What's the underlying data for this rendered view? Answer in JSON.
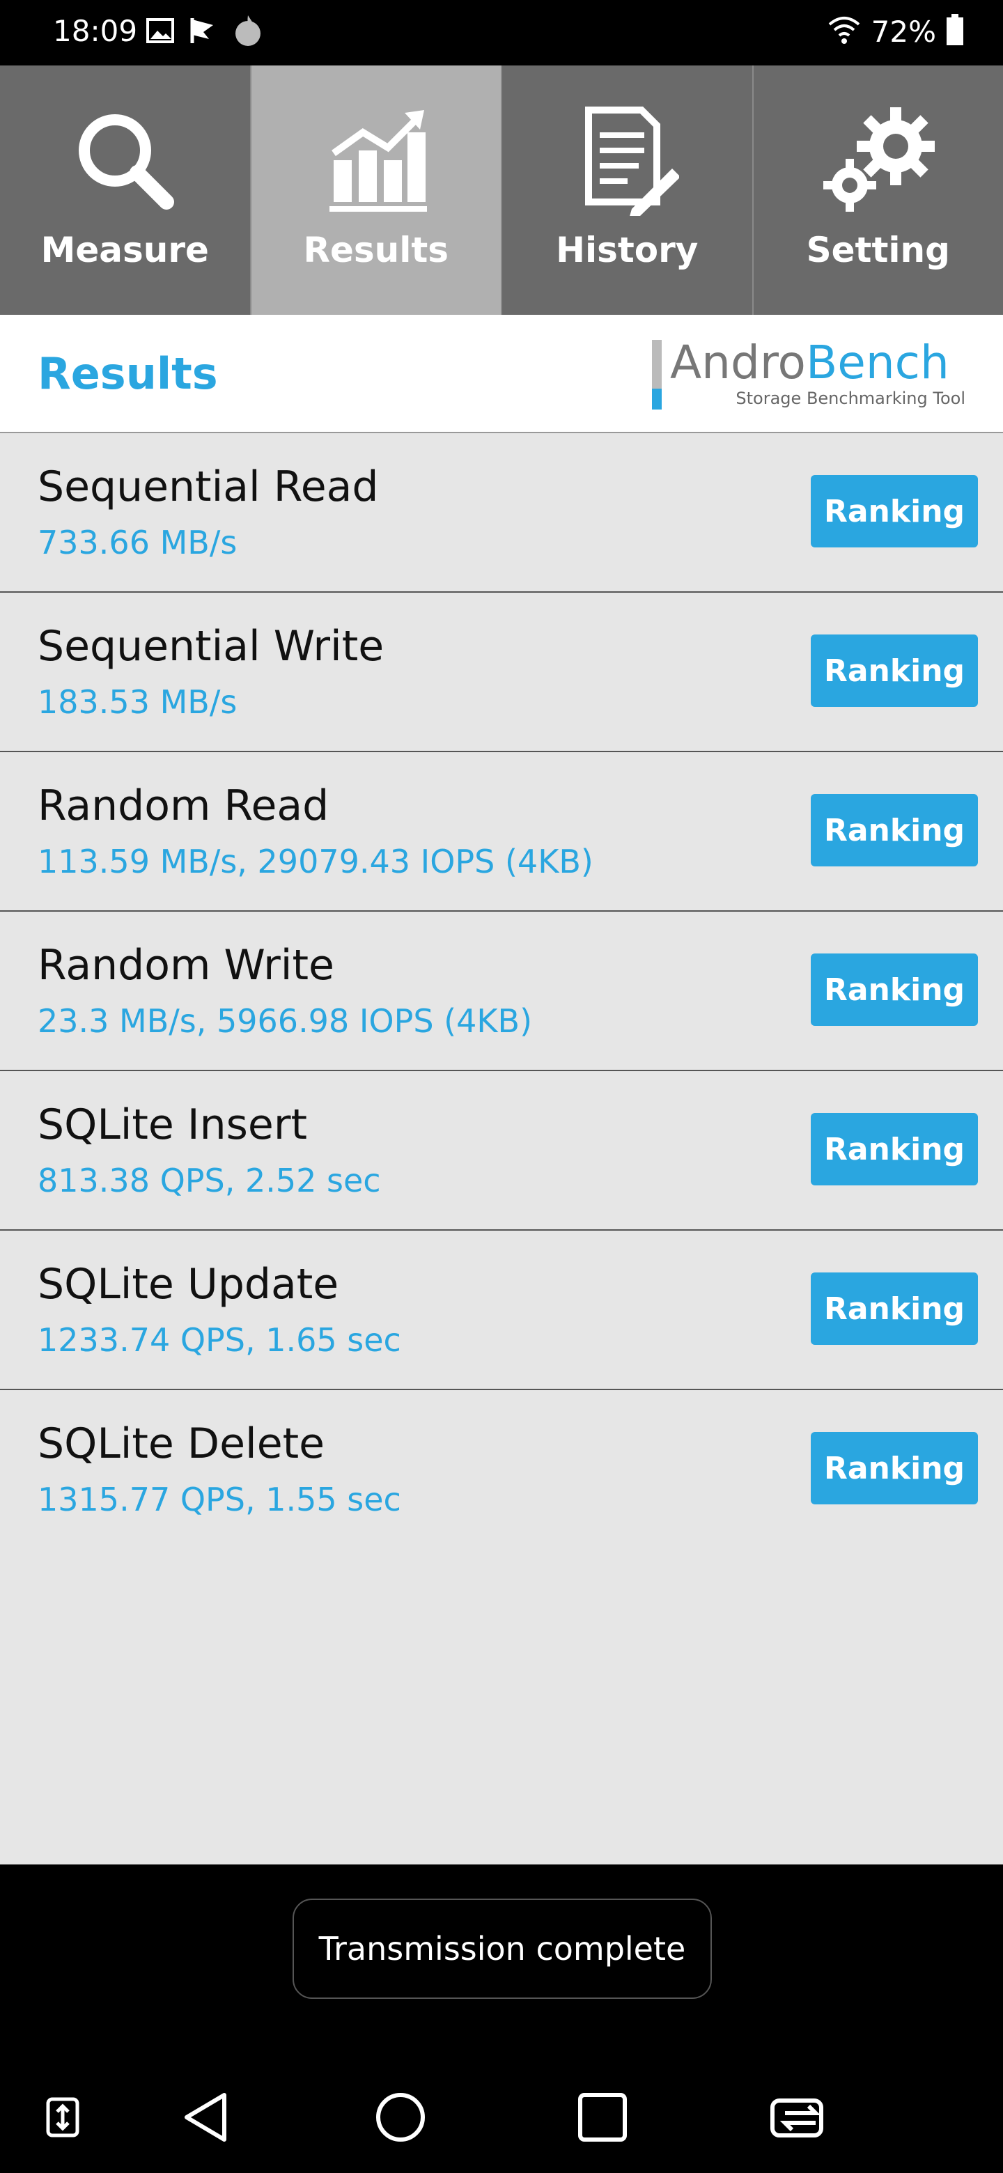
{
  "status_bar": {
    "time": "18:09",
    "left_icons": [
      "image-icon",
      "check-flag-icon",
      "flame-icon"
    ],
    "battery_percent": "72%",
    "right_icons": [
      "wifi-icon",
      "battery-icon"
    ]
  },
  "tabs": [
    {
      "label": "Measure",
      "icon": "search-icon",
      "active": false
    },
    {
      "label": "Results",
      "icon": "chart-icon",
      "active": true
    },
    {
      "label": "History",
      "icon": "document-edit-icon",
      "active": false
    },
    {
      "label": "Setting",
      "icon": "gears-icon",
      "active": false
    }
  ],
  "header": {
    "title": "Results",
    "logo_andro": "Andro",
    "logo_bench": "Bench",
    "logo_tagline": "Storage Benchmarking Tool"
  },
  "results": [
    {
      "name": "Sequential Read",
      "value": "733.66 MB/s",
      "button": "Ranking"
    },
    {
      "name": "Sequential Write",
      "value": "183.53 MB/s",
      "button": "Ranking"
    },
    {
      "name": "Random Read",
      "value": "113.59 MB/s, 29079.43 IOPS (4KB)",
      "button": "Ranking"
    },
    {
      "name": "Random Write",
      "value": "23.3 MB/s, 5966.98 IOPS (4KB)",
      "button": "Ranking"
    },
    {
      "name": "SQLite Insert",
      "value": "813.38 QPS, 2.52 sec",
      "button": "Ranking"
    },
    {
      "name": "SQLite Update",
      "value": "1233.74 QPS, 1.65 sec",
      "button": "Ranking"
    },
    {
      "name": "SQLite Delete",
      "value": "1315.77 QPS, 1.55 sec",
      "button": "Ranking"
    }
  ],
  "toast": "Transmission complete",
  "nav": [
    "scroll-capture-icon",
    "back-icon",
    "home-icon",
    "recents-icon",
    "switch-apps-icon"
  ],
  "colors": {
    "accent": "#2aa6e0",
    "tab_bg": "#6a6a6a",
    "tab_active_bg": "#b0b0b0",
    "list_bg": "#e6e6e6"
  }
}
